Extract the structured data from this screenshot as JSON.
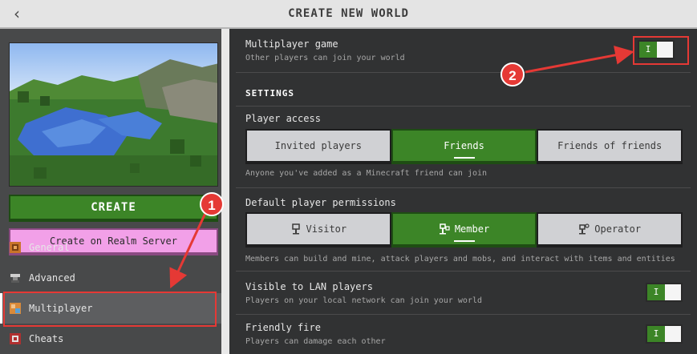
{
  "header": {
    "back_icon": "chevron-left-icon",
    "title": "CREATE NEW WORLD"
  },
  "left": {
    "create_label": "CREATE",
    "realm_label": "Create on Realm Server",
    "nav": [
      {
        "icon": "settings-gear-icon",
        "label": "General",
        "selected": false
      },
      {
        "icon": "anvil-icon",
        "label": "Advanced",
        "selected": false
      },
      {
        "icon": "players-icon",
        "label": "Multiplayer",
        "selected": true
      },
      {
        "icon": "cheats-icon",
        "label": "Cheats",
        "selected": false
      }
    ]
  },
  "right": {
    "multiplayer": {
      "label": "Multiplayer game",
      "sub": "Other players can join your world",
      "toggle_on": true,
      "toggle_text": "I"
    },
    "settings_heading": "SETTINGS",
    "player_access": {
      "label": "Player access",
      "options": [
        "Invited players",
        "Friends",
        "Friends of friends"
      ],
      "selected": "Friends",
      "hint": "Anyone you've added as a Minecraft friend can join"
    },
    "permissions": {
      "label": "Default player permissions",
      "options": [
        {
          "icon": "visitor-icon",
          "label": "Visitor"
        },
        {
          "icon": "member-icon",
          "label": "Member"
        },
        {
          "icon": "operator-icon",
          "label": "Operator"
        }
      ],
      "selected": "Member",
      "hint": "Members can build and mine, attack players and mobs, and interact with items and entities"
    },
    "lan": {
      "label": "Visible to LAN players",
      "sub": "Players on your local network can join your world",
      "toggle_on": true,
      "toggle_text": "I"
    },
    "friendly_fire": {
      "label": "Friendly fire",
      "sub": "Players can damage each other",
      "toggle_on": true,
      "toggle_text": "I"
    }
  },
  "annotations": {
    "step1": "1",
    "step2": "2"
  },
  "colors": {
    "accent_green": "#3c8527",
    "realm_pink": "#f2a0e8",
    "annotation_red": "#e53935"
  }
}
